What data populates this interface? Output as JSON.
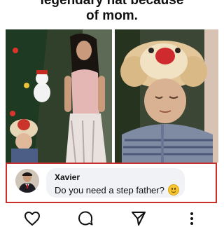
{
  "post": {
    "caption_line1": "legendary hat because",
    "caption_line2": "of mom."
  },
  "comment": {
    "author": "Xavier",
    "text": "Do you need a step father?",
    "emoji_icon": "smiley-emoji-icon"
  },
  "actions": {
    "like_icon": "heart-icon",
    "comment_icon": "comment-icon",
    "share_icon": "send-icon",
    "more_icon": "more-vertical-icon"
  },
  "colors": {
    "highlight_border": "#c9302c",
    "bubble_bg": "#f0f2f5"
  }
}
